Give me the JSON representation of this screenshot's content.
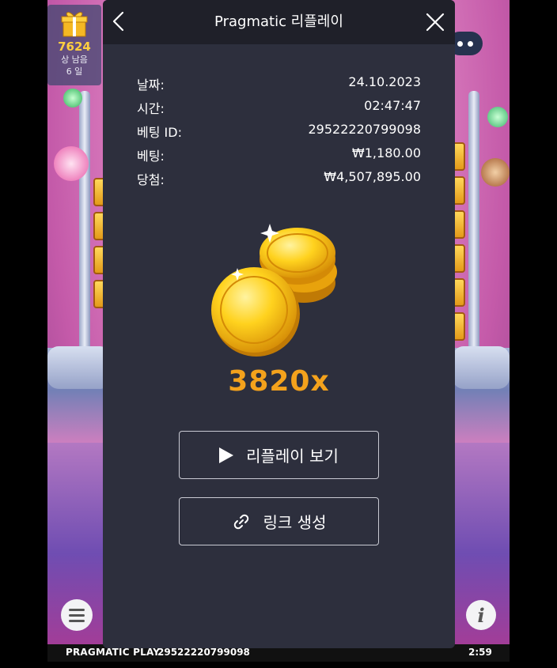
{
  "gift": {
    "count": "7624",
    "line1": "상 남음",
    "line2": "6 일"
  },
  "dialog": {
    "title": "Pragmatic 리플레이",
    "rows": [
      {
        "label": "날짜:",
        "value": "24.10.2023"
      },
      {
        "label": "시간:",
        "value": "02:47:47"
      },
      {
        "label": "베팅 ID:",
        "value": "29522220799098"
      },
      {
        "label": "베팅:",
        "value": "₩1,180.00"
      },
      {
        "label": "당첨:",
        "value": "₩4,507,895.00"
      }
    ],
    "multiplier": "3820x",
    "replay_label": "리플레이 보기",
    "link_label": "링크 생성"
  },
  "status_bar": {
    "brand": "PRAGMATIC PLAY",
    "round_id": "29522220799098",
    "clock": "2:59"
  },
  "icons": {
    "gift": "gift-icon",
    "back": "chevron-left-icon",
    "close": "close-icon",
    "play": "play-icon",
    "link": "link-icon",
    "menu": "hamburger-menu-icon",
    "info": "info-icon",
    "more": "more-dots-icon"
  },
  "colors": {
    "accent": "#f4a21c",
    "dialog_bg": "#2d2f3d",
    "header_bg": "#1f2029",
    "gift_count": "#ffcf3f"
  }
}
